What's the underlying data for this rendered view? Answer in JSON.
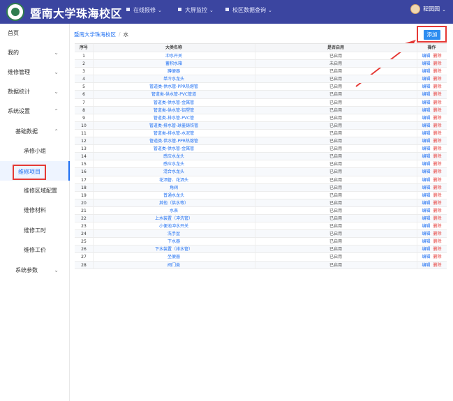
{
  "header": {
    "title": "暨南大学珠海校区",
    "nav": [
      {
        "label": "在线报修"
      },
      {
        "label": "大屏监控"
      },
      {
        "label": "校区数据查询"
      }
    ],
    "user": "程园园"
  },
  "sidebar": {
    "items": [
      {
        "label": "首页",
        "level": 0,
        "chevron": ""
      },
      {
        "label": "我的",
        "level": 0,
        "chevron": "⌄"
      },
      {
        "label": "维修管理",
        "level": 0,
        "chevron": "⌄"
      },
      {
        "label": "数据统计",
        "level": 0,
        "chevron": "⌄"
      },
      {
        "label": "系统设置",
        "level": 0,
        "chevron": "⌃"
      },
      {
        "label": "基础数据",
        "level": 1,
        "chevron": "⌃"
      },
      {
        "label": "承修小组",
        "level": 2,
        "chevron": ""
      },
      {
        "label": "维修项目",
        "level": 2,
        "chevron": "",
        "active": true
      },
      {
        "label": "维修区域配置",
        "level": 2,
        "chevron": ""
      },
      {
        "label": "维修材料",
        "level": 2,
        "chevron": ""
      },
      {
        "label": "维修工时",
        "level": 2,
        "chevron": ""
      },
      {
        "label": "维修工价",
        "level": 2,
        "chevron": ""
      },
      {
        "label": "系统参数",
        "level": 1,
        "chevron": "⌄"
      }
    ]
  },
  "breadcrumb": {
    "root": "暨南大学珠海校区",
    "separator": "/",
    "current": "水"
  },
  "toolbar": {
    "add_label": "添加"
  },
  "table": {
    "headers": {
      "index": "序号",
      "name": "大类名称",
      "enabled": "是否启用",
      "ops": "操作"
    },
    "edit_label": "编辑",
    "delete_label": "删除",
    "rows": [
      {
        "index": "1",
        "name": "冲水开关",
        "status": "已启用"
      },
      {
        "index": "2",
        "name": "蓄积水箱",
        "status": "未启用"
      },
      {
        "index": "3",
        "name": "蹲便器",
        "status": "已启用"
      },
      {
        "index": "4",
        "name": "单冷水龙头",
        "status": "已启用"
      },
      {
        "index": "5",
        "name": "管道类-供水管-PPR热熔管",
        "status": "已启用"
      },
      {
        "index": "6",
        "name": "管道类-供水管-PVC管道",
        "status": "已启用"
      },
      {
        "index": "7",
        "name": "管道类-供水管-金属管",
        "status": "已启用"
      },
      {
        "index": "8",
        "name": "管道类-供水管-铝塑管",
        "status": "已启用"
      },
      {
        "index": "9",
        "name": "管道类-排水管-PVC管",
        "status": "已启用"
      },
      {
        "index": "10",
        "name": "管道类-排水管-球墨铸铁管",
        "status": "已启用"
      },
      {
        "index": "11",
        "name": "管道类-排水管-水泥管",
        "status": "已启用"
      },
      {
        "index": "12",
        "name": "管道类-供水管-PPR热熔管",
        "status": "已启用"
      },
      {
        "index": "13",
        "name": "管道类-供水管-金属管",
        "status": "已启用"
      },
      {
        "index": "14",
        "name": "感应水龙头",
        "status": "已启用"
      },
      {
        "index": "15",
        "name": "感应水龙头",
        "status": "已启用"
      },
      {
        "index": "16",
        "name": "混合水龙头",
        "status": "已启用"
      },
      {
        "index": "17",
        "name": "花洒管、花洒头",
        "status": "已启用"
      },
      {
        "index": "18",
        "name": "角阀",
        "status": "已启用"
      },
      {
        "index": "19",
        "name": "普通水龙头",
        "status": "已启用"
      },
      {
        "index": "20",
        "name": "其他（供水等）",
        "status": "已启用"
      },
      {
        "index": "21",
        "name": "水表",
        "status": "已启用"
      },
      {
        "index": "22",
        "name": "上水装置（冲洗管）",
        "status": "已启用"
      },
      {
        "index": "23",
        "name": "小便池冲水开关",
        "status": "已启用"
      },
      {
        "index": "24",
        "name": "洗手盆",
        "status": "已启用"
      },
      {
        "index": "25",
        "name": "下水器",
        "status": "已启用"
      },
      {
        "index": "26",
        "name": "下水装置（排水管）",
        "status": "已启用"
      },
      {
        "index": "27",
        "name": "坐便器",
        "status": "已启用"
      },
      {
        "index": "28",
        "name": "阀门类",
        "status": "已启用"
      }
    ]
  },
  "colors": {
    "header_bg": "#3b45a0",
    "accent": "#1e6ff2",
    "danger": "#e53935",
    "add_button": "#2d8cf0"
  }
}
